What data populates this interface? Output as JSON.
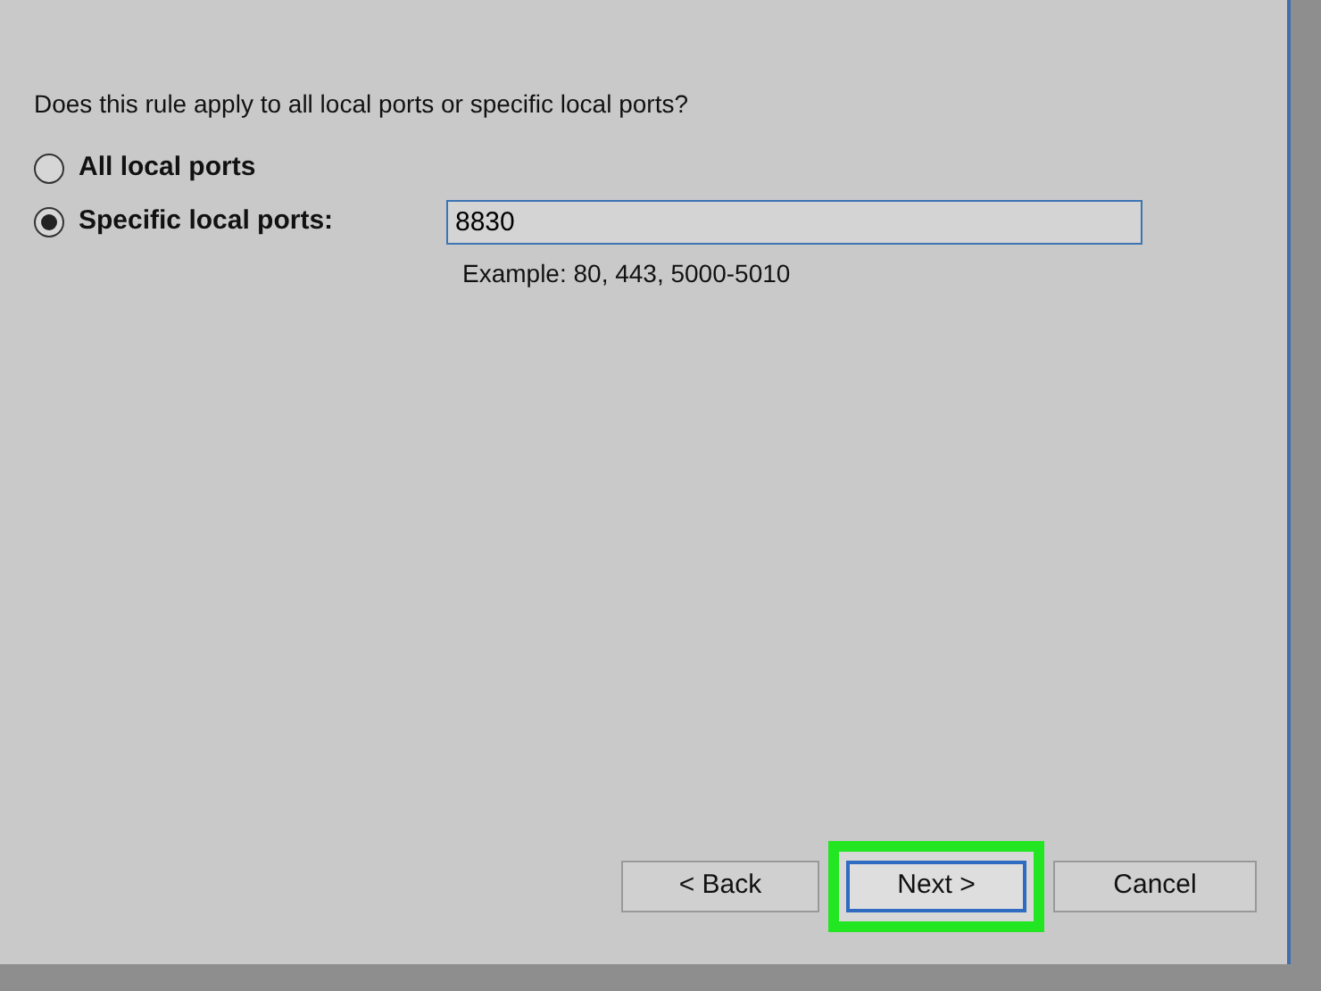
{
  "question": "Does this rule apply to all local ports or specific local ports?",
  "options": [
    {
      "label": "All local ports",
      "selected": false
    },
    {
      "label": "Specific local ports:",
      "selected": true
    }
  ],
  "ports_field": {
    "value": "8830",
    "hint": "Example: 80, 443, 5000-5010"
  },
  "buttons": [
    {
      "label": "< Back",
      "default": false,
      "highlighted": false
    },
    {
      "label": "Next >",
      "default": true,
      "highlighted": true
    },
    {
      "label": "Cancel",
      "default": false,
      "highlighted": false
    }
  ]
}
